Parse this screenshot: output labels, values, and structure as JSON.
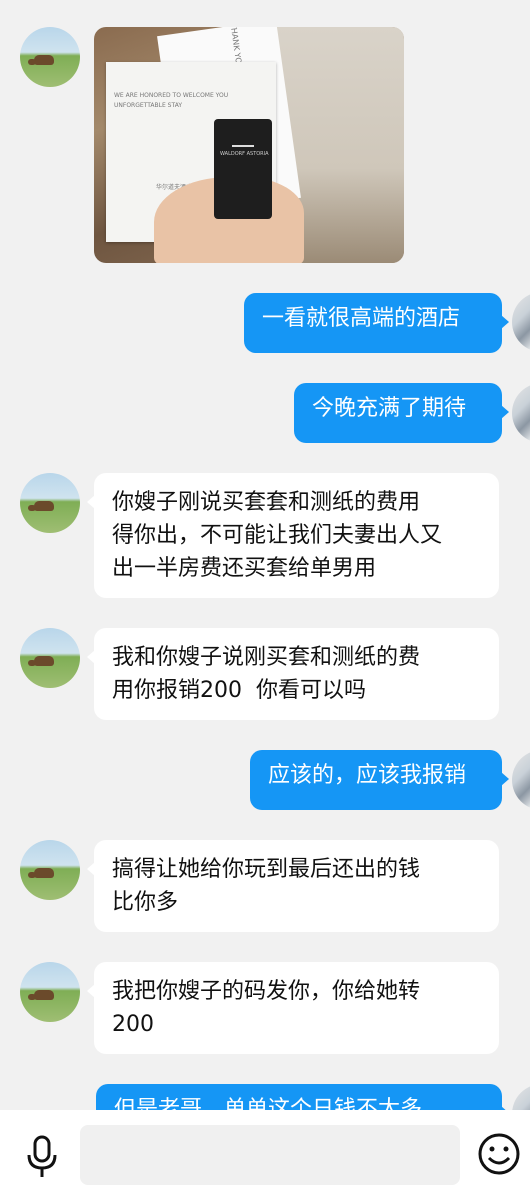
{
  "messages": [
    {
      "side": "left",
      "type": "image",
      "alt_texts": {
        "card_top": "THANK YOU F",
        "card_line1": "WE ARE HONORED TO WELCOME YOU",
        "card_line2": "UNFORGETTABLE STAY",
        "card_sig": "华尔道夫酒店",
        "keycard_brand": "WALDORF ASTORIA"
      }
    },
    {
      "side": "right",
      "type": "text",
      "lines": [
        "一看就很高端的酒店"
      ]
    },
    {
      "side": "right",
      "type": "text",
      "lines": [
        "今晚充满了期待"
      ]
    },
    {
      "side": "left",
      "type": "text",
      "lines": [
        "你嫂子刚说买套套和测纸的费用",
        "得你出，不可能让我们夫妻出人又",
        "出一半房费还买套给单男用"
      ]
    },
    {
      "side": "left",
      "type": "text",
      "lines": [
        "我和你嫂子说刚买套和测纸的费",
        "用你报销200  你看可以吗"
      ]
    },
    {
      "side": "right",
      "type": "text",
      "lines": [
        "应该的，应该我报销"
      ]
    },
    {
      "side": "left",
      "type": "text",
      "lines": [
        "搞得让她给你玩到最后还出的钱",
        "比你多"
      ]
    },
    {
      "side": "left",
      "type": "text",
      "lines": [
        "我把你嫂子的码发你，你给她转",
        "200"
      ]
    },
    {
      "side": "right",
      "type": "text",
      "lines": [
        "但是老哥，单单这个日钱不太多"
      ]
    }
  ],
  "input_bar": {
    "placeholder": "",
    "left_icon": "microphone-icon",
    "right_icon": "emoji-icon"
  },
  "colors": {
    "right_bubble": "#1596f5",
    "left_bubble": "#ffffff",
    "background": "#f1f1f1"
  }
}
